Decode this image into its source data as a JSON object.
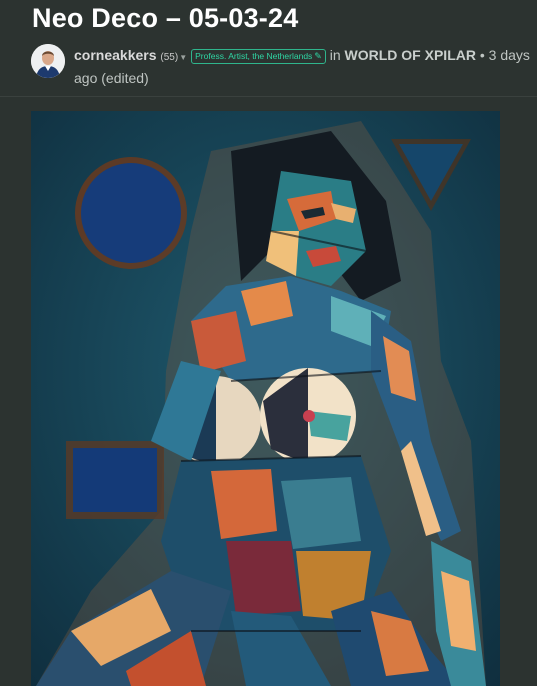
{
  "post": {
    "title": "Neo Deco – 05-03-24",
    "author": "corneakkers",
    "reputation": "(55)",
    "badge": "Profess. Artist, the Netherlands",
    "in_label": "in",
    "community": "WORLD OF XPILAR",
    "bullet": "•",
    "time": "3 days ago",
    "edited": "(edited)"
  },
  "icons": {
    "dropdown": "caret-down-icon",
    "badge_edit": "pencil-icon"
  },
  "colors": {
    "background": "#2c3330",
    "badge_accent": "#2fd6a4"
  }
}
